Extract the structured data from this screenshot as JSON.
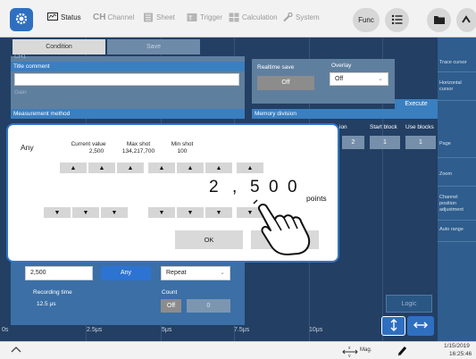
{
  "toolbar": {
    "tabs": [
      {
        "label": "Status",
        "active": true
      },
      {
        "label": "Channel",
        "prefix": "CH",
        "active": false
      },
      {
        "label": "Sheet",
        "active": false
      },
      {
        "label": "Trigger",
        "active": false
      },
      {
        "label": "Calculation",
        "active": false
      },
      {
        "label": "System",
        "active": false
      }
    ],
    "func_label": "Func",
    "icons": [
      "gear-icon",
      "list-icon",
      "folder-icon",
      "wave-icon"
    ]
  },
  "screen": {
    "condition_tab": "Condition",
    "save_tab": "Save",
    "ch_label": "CH1",
    "gain_label": "Gain",
    "title_comment_label": "Title comment",
    "title_comment_value": "",
    "realtime_save_label": "Realtime save",
    "realtime_save_value": "Off",
    "overlay_label": "Overlay",
    "overlay_value": "Off",
    "execute_label": "Execute",
    "measurement_method_label": "Measurement method",
    "memory_division_label": "Memory division",
    "memory_division_cols": {
      "col1": "ion",
      "col2": "Start block",
      "col3": "Use blocks"
    },
    "memory_division_values": {
      "v1": "2",
      "v2": "1",
      "v3": "1"
    },
    "recording_length_value": "2,500",
    "any_button": "Any",
    "repeat_value": "Repeat",
    "recording_time_label": "Recording time",
    "recording_time_value": "12.5 μs",
    "count_label": "Count",
    "count_off": "Off",
    "count_value": "0",
    "logic_label": "Logic",
    "axis_labels": [
      "0s",
      "2.5μs",
      "5μs",
      "7.5μs",
      "10μs"
    ]
  },
  "right_panel": {
    "items": [
      "Trace cursor",
      "Horizontal cursor",
      "Page",
      "Zoom",
      "Channel position adjustment",
      "Auto range"
    ]
  },
  "bottom_bar": {
    "mag_label": "Mag.",
    "date": "1/15/2019",
    "time": "16:25:46"
  },
  "dialog": {
    "title": "Any",
    "current_value_label": "Current value",
    "current_value": "2,500",
    "max_shot_label": "Max shot",
    "max_shot": "134,217,700",
    "min_shot_label": "Min shot",
    "min_shot": "100",
    "digits": [
      "2",
      ",",
      "5",
      "0",
      "0"
    ],
    "unit": "points",
    "ok_label": "OK",
    "cancel_label": "Cancel"
  }
}
